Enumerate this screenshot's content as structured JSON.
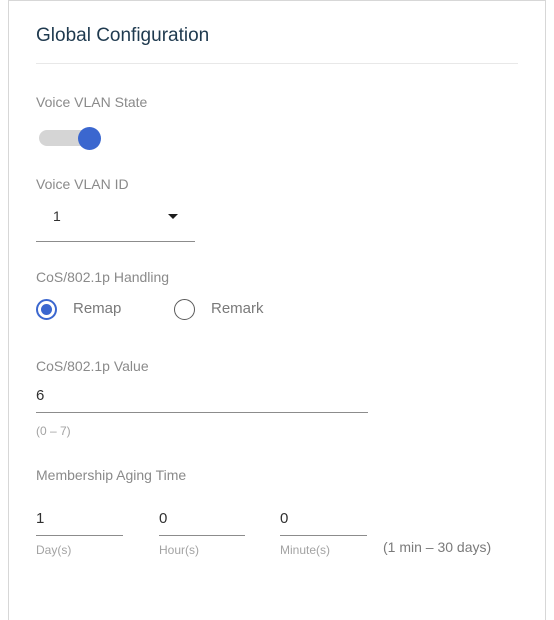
{
  "panel": {
    "title": "Global Configuration"
  },
  "voice_vlan_state": {
    "label": "Voice VLAN State",
    "enabled": true
  },
  "voice_vlan_id": {
    "label": "Voice VLAN ID",
    "value": "1"
  },
  "cos_handling": {
    "label": "CoS/802.1p Handling",
    "options": [
      {
        "label": "Remap",
        "selected": true
      },
      {
        "label": "Remark",
        "selected": false
      }
    ]
  },
  "cos_value": {
    "label": "CoS/802.1p Value",
    "value": "6",
    "range": "(0 – 7)"
  },
  "aging_time": {
    "label": "Membership Aging Time",
    "day": {
      "value": "1",
      "unit": "Day(s)"
    },
    "hour": {
      "value": "0",
      "unit": "Hour(s)"
    },
    "minute": {
      "value": "0",
      "unit": "Minute(s)"
    },
    "range": "(1 min – 30 days)"
  },
  "colors": {
    "accent": "#3b67cf",
    "title": "#1f3a4f",
    "label": "#8a8a8a"
  }
}
